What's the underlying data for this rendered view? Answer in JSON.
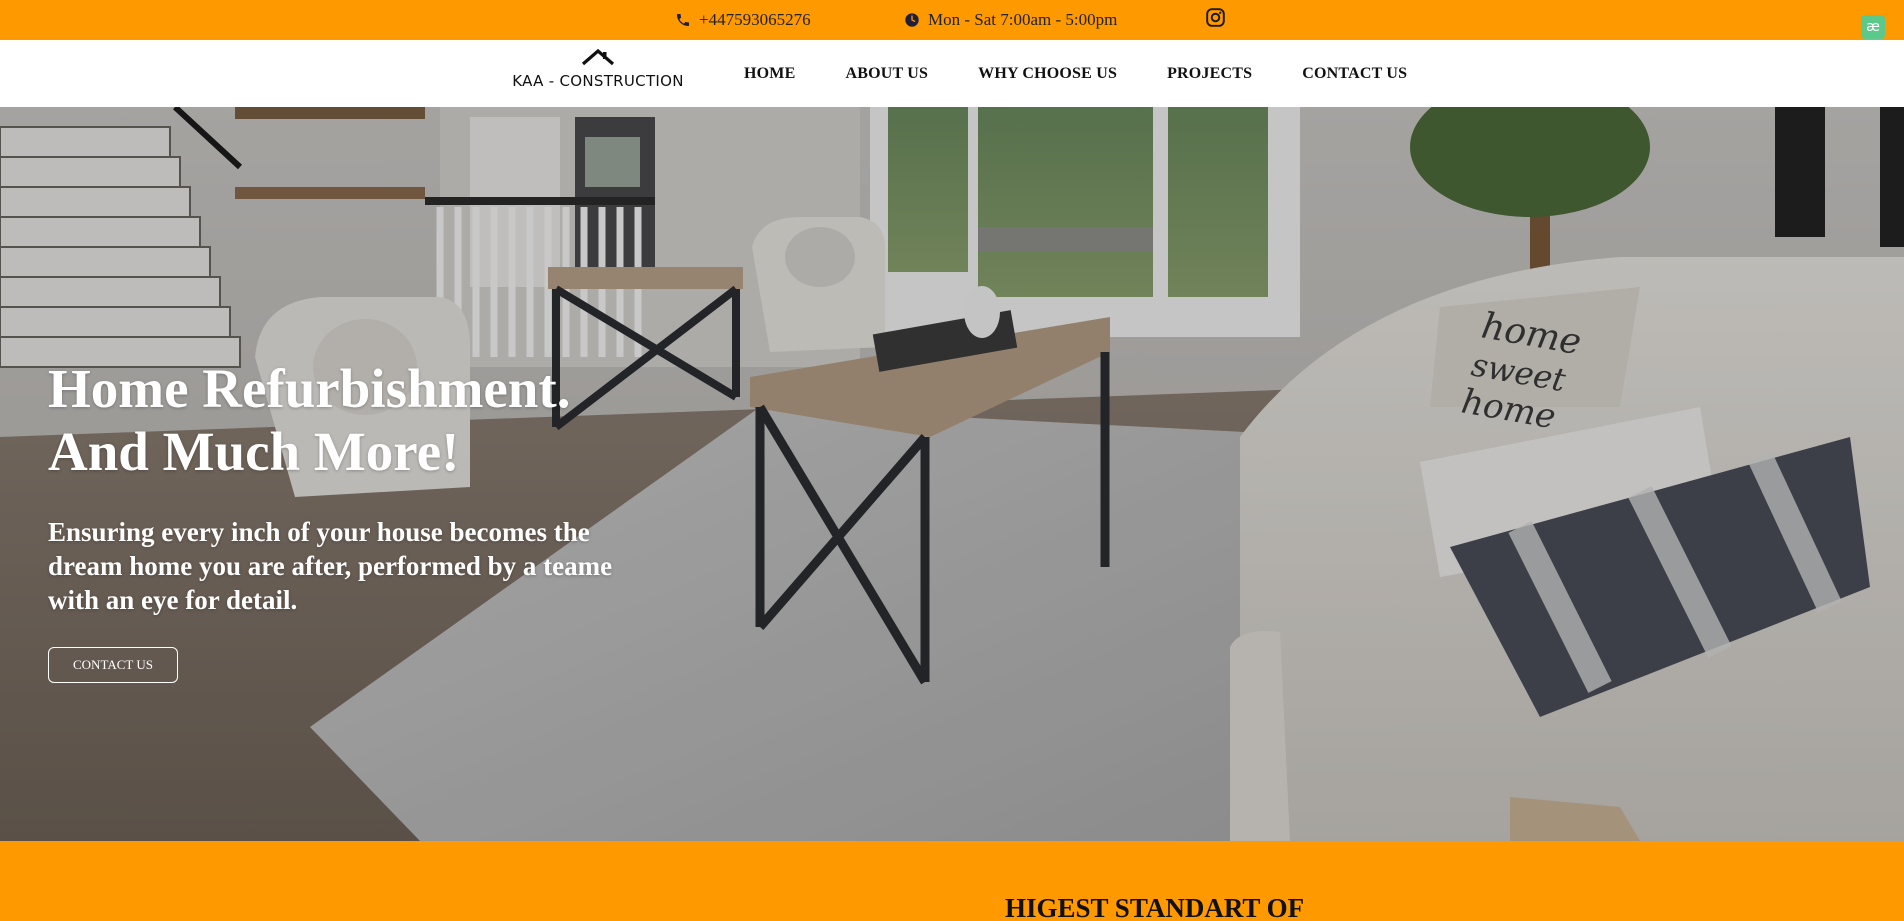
{
  "topbar": {
    "phone": "+447593065276",
    "hours": "Mon - Sat 7:00am - 5:00pm",
    "phone_icon": "phone-icon",
    "hours_icon": "clock-icon",
    "social_icon": "instagram-icon",
    "background": "#ff9900",
    "extension_badge": "æ"
  },
  "nav": {
    "logo_text": "KAA - CONSTRUCTION",
    "logo_icon": "house-roof-icon",
    "items": [
      {
        "label": "HOME"
      },
      {
        "label": "ABOUT US"
      },
      {
        "label": "WHY CHOOSE US"
      },
      {
        "label": "PROJECTS"
      },
      {
        "label": "CONTACT US"
      }
    ]
  },
  "hero": {
    "title_line1": "Home Refurbishment.",
    "title_line2": "And Much More!",
    "subtitle": "Ensuring every inch of your house becomes the dream home you are after, performed by a teame with an eye for detail.",
    "cta_label": "CONTACT US",
    "pillow_text_1": "home",
    "pillow_text_2": "sweet",
    "pillow_text_3": "home"
  },
  "section": {
    "heading": "HIGEST STANDART OF",
    "background": "#ff9900"
  }
}
